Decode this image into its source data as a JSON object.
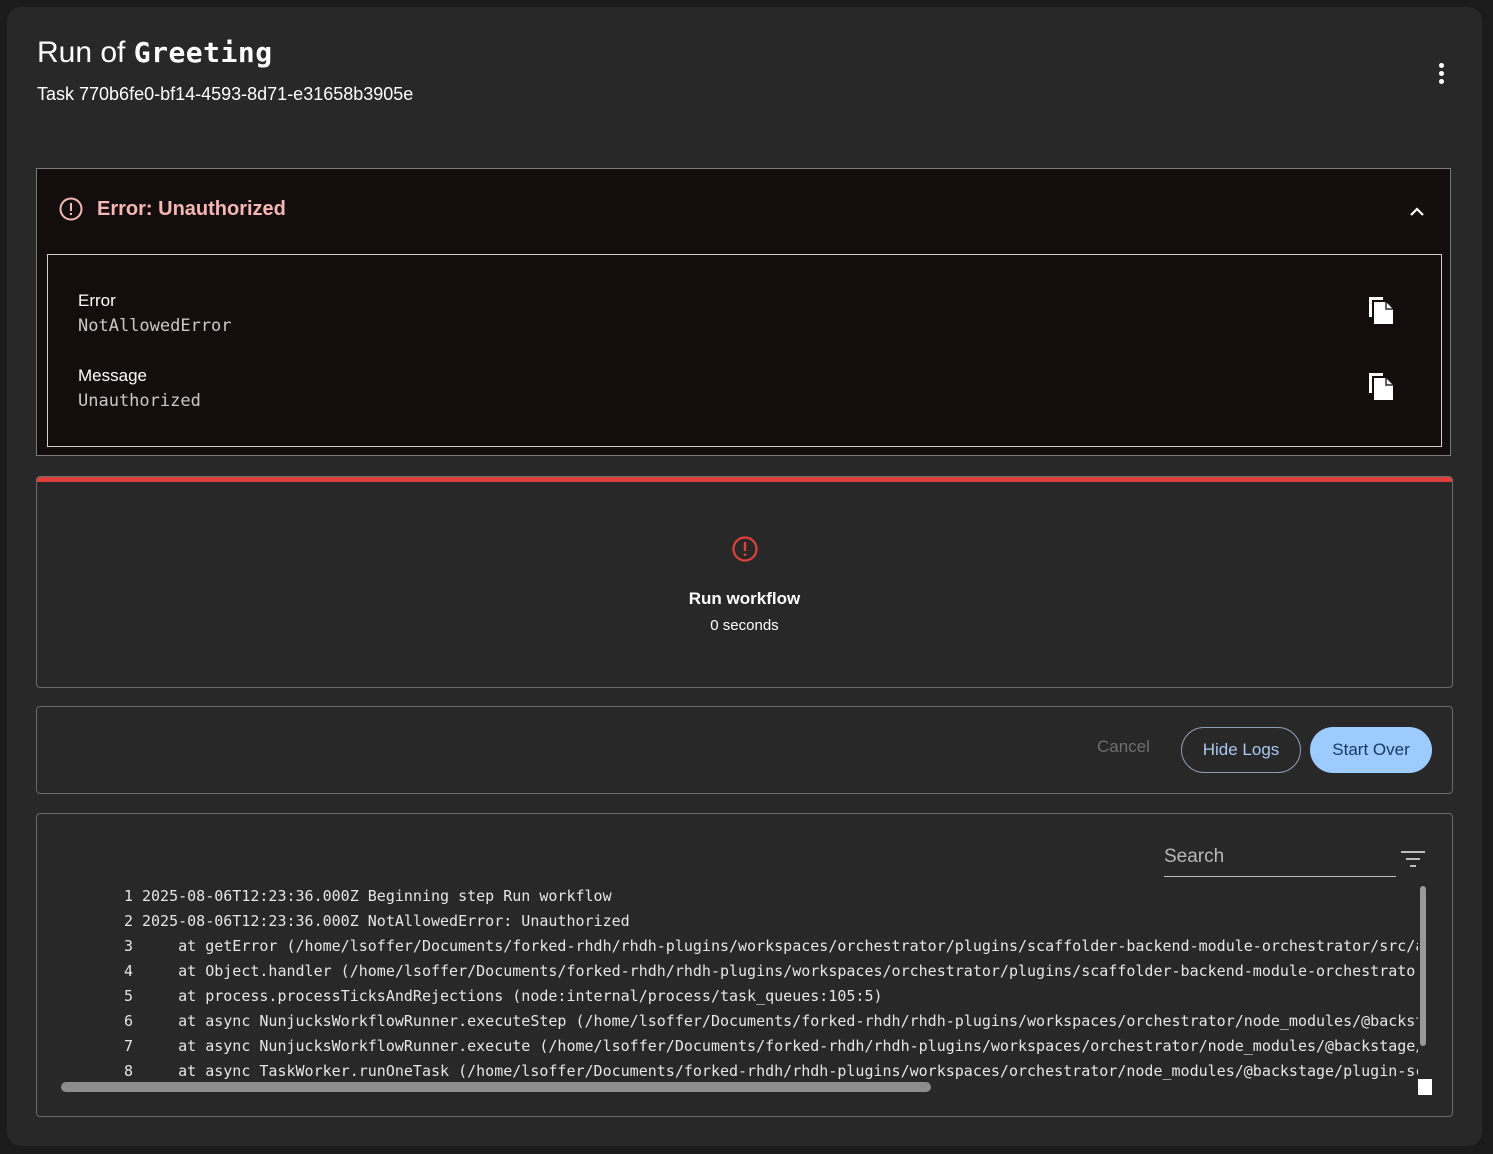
{
  "header": {
    "title_prefix": "Run of",
    "title_template": "Greeting",
    "task_label": "Task 770b6fe0-bf14-4593-8d71-e31658b3905e",
    "menu_icon": "more-vertical-icon"
  },
  "error_panel": {
    "title": "Error: Unauthorized",
    "icon": "error-circle-icon",
    "collapse_icon": "chevron-up-icon",
    "fields": [
      {
        "label": "Error",
        "value": "NotAllowedError",
        "copy_icon": "copy-icon"
      },
      {
        "label": "Message",
        "value": "Unauthorized",
        "copy_icon": "copy-icon"
      }
    ],
    "title_color": "#f7b7b2"
  },
  "step": {
    "name": "Run workflow",
    "duration": "0 seconds",
    "status_color": "#e0403a",
    "icon": "error-circle-icon"
  },
  "actions": {
    "cancel_label": "Cancel",
    "hide_logs_label": "Hide Logs",
    "start_over_label": "Start Over",
    "accent_color": "#9ecbff"
  },
  "logs": {
    "search_placeholder": "Search",
    "filter_icon": "filter-icon",
    "lines": [
      {
        "n": "1",
        "text": "2025-08-06T12:23:36.000Z Beginning step Run workflow"
      },
      {
        "n": "2",
        "text": "2025-08-06T12:23:36.000Z NotAllowedError: Unauthorized"
      },
      {
        "n": "3",
        "text": "    at getError (/home/lsoffer/Documents/forked-rhdh/rhdh-plugins/workspaces/orchestrator/plugins/scaffolder-backend-module-orchestrator/src/a"
      },
      {
        "n": "4",
        "text": "    at Object.handler (/home/lsoffer/Documents/forked-rhdh/rhdh-plugins/workspaces/orchestrator/plugins/scaffolder-backend-module-orchestrator"
      },
      {
        "n": "5",
        "text": "    at process.processTicksAndRejections (node:internal/process/task_queues:105:5)"
      },
      {
        "n": "6",
        "text": "    at async NunjucksWorkflowRunner.executeStep (/home/lsoffer/Documents/forked-rhdh/rhdh-plugins/workspaces/orchestrator/node_modules/@backst"
      },
      {
        "n": "7",
        "text": "    at async NunjucksWorkflowRunner.execute (/home/lsoffer/Documents/forked-rhdh/rhdh-plugins/workspaces/orchestrator/node_modules/@backstage/"
      },
      {
        "n": "8",
        "text": "    at async TaskWorker.runOneTask (/home/lsoffer/Documents/forked-rhdh/rhdh-plugins/workspaces/orchestrator/node_modules/@backstage/plugin-sc"
      }
    ]
  }
}
